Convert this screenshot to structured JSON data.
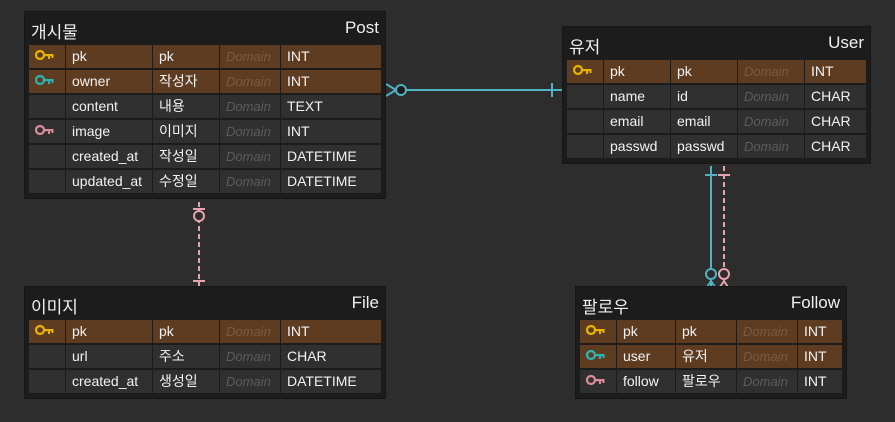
{
  "colors": {
    "background": "#2d2d2d",
    "table_bg": "#1c1c1c",
    "cell_bg": "#303030",
    "key_row_bg": "#5e3c22",
    "pk_icon": "#e8b400",
    "fk_icon": "#2bb5b5",
    "pfk_icon": "#d98b9a",
    "rel_teal": "#4fb3c4",
    "rel_pink": "#e8a3b0"
  },
  "domain_placeholder": "Domain",
  "entities": {
    "post": {
      "logical_name": "개시물",
      "physical_name": "Post",
      "columns": [
        {
          "icon": "pk-key-icon",
          "key": true,
          "physical": "pk",
          "logical": "pk",
          "domain": "Domain",
          "type": "INT"
        },
        {
          "icon": "fk-key-icon",
          "key": true,
          "physical": "owner",
          "logical": "작성자",
          "domain": "Domain",
          "type": "INT"
        },
        {
          "icon": "",
          "key": false,
          "physical": "content",
          "logical": "내용",
          "domain": "Domain",
          "type": "TEXT"
        },
        {
          "icon": "pfk-key-icon",
          "key": false,
          "physical": "image",
          "logical": "이미지",
          "domain": "Domain",
          "type": "INT"
        },
        {
          "icon": "",
          "key": false,
          "physical": "created_at",
          "logical": "작성일",
          "domain": "Domain",
          "type": "DATETIME"
        },
        {
          "icon": "",
          "key": false,
          "physical": "updated_at",
          "logical": "수정일",
          "domain": "Domain",
          "type": "DATETIME"
        }
      ]
    },
    "user": {
      "logical_name": "유저",
      "physical_name": "User",
      "columns": [
        {
          "icon": "pk-key-icon",
          "key": true,
          "physical": "pk",
          "logical": "pk",
          "domain": "Domain",
          "type": "INT"
        },
        {
          "icon": "",
          "key": false,
          "physical": "name",
          "logical": "id",
          "domain": "Domain",
          "type": "CHAR"
        },
        {
          "icon": "",
          "key": false,
          "physical": "email",
          "logical": "email",
          "domain": "Domain",
          "type": "CHAR"
        },
        {
          "icon": "",
          "key": false,
          "physical": "passwd",
          "logical": "passwd",
          "domain": "Domain",
          "type": "CHAR"
        }
      ]
    },
    "file": {
      "logical_name": "이미지",
      "physical_name": "File",
      "columns": [
        {
          "icon": "pk-key-icon",
          "key": true,
          "physical": "pk",
          "logical": "pk",
          "domain": "Domain",
          "type": "INT"
        },
        {
          "icon": "",
          "key": false,
          "physical": "url",
          "logical": "주소",
          "domain": "Domain",
          "type": "CHAR"
        },
        {
          "icon": "",
          "key": false,
          "physical": "created_at",
          "logical": "생성일",
          "domain": "Domain",
          "type": "DATETIME"
        }
      ]
    },
    "follow": {
      "logical_name": "팔로우",
      "physical_name": "Follow",
      "columns": [
        {
          "icon": "pk-key-icon",
          "key": true,
          "physical": "pk",
          "logical": "pk",
          "domain": "Domain",
          "type": "INT"
        },
        {
          "icon": "fk-key-icon",
          "key": true,
          "physical": "user",
          "logical": "유저",
          "domain": "Domain",
          "type": "INT"
        },
        {
          "icon": "pfk-key-icon",
          "key": false,
          "physical": "follow",
          "logical": "팔로우",
          "domain": "Domain",
          "type": "INT"
        }
      ]
    }
  },
  "relationships": [
    {
      "from": "user",
      "to": "post",
      "style": "solid",
      "color": "teal",
      "start": "one",
      "end": "zero-or-many"
    },
    {
      "from": "file",
      "to": "post",
      "style": "dashed",
      "color": "pink",
      "start": "one",
      "end": "zero-or-one"
    },
    {
      "from": "user",
      "to": "follow",
      "style": "solid",
      "color": "teal",
      "start": "one",
      "end": "zero-or-many"
    },
    {
      "from": "user",
      "to": "follow",
      "style": "dashed",
      "color": "pink",
      "start": "one",
      "end": "zero-or-many"
    }
  ]
}
